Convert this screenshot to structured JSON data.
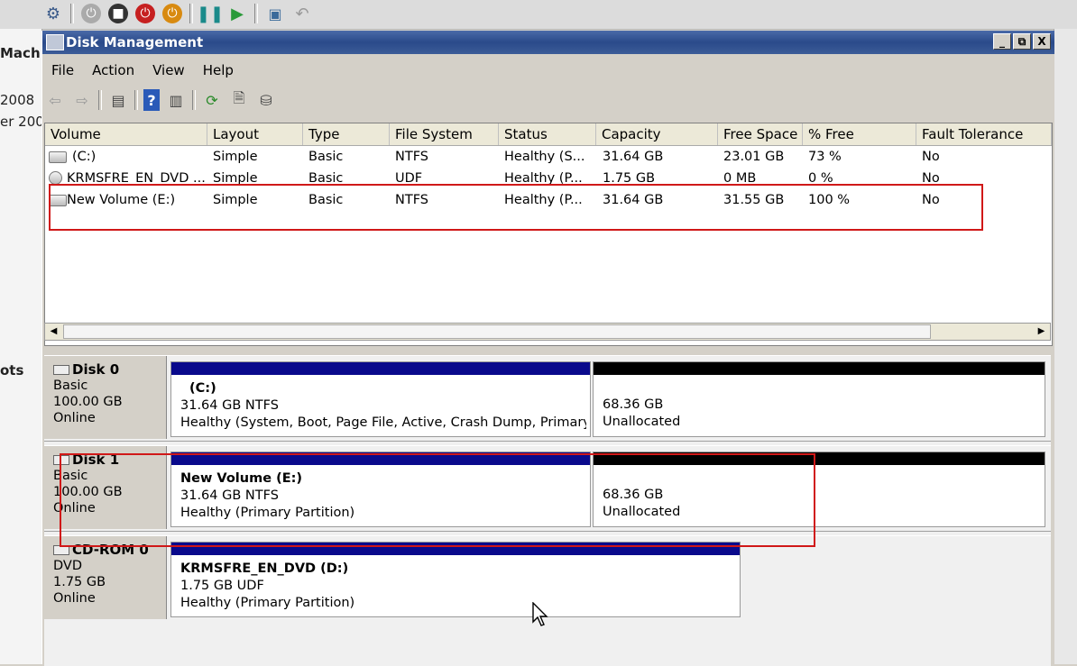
{
  "host": {
    "left_labels": [
      "Mach",
      "2008",
      "er 200",
      "ots"
    ]
  },
  "window": {
    "title": "Disk Management",
    "buttons": [
      "_",
      "⧉",
      "X"
    ]
  },
  "menu": [
    "File",
    "Action",
    "View",
    "Help"
  ],
  "volumes": {
    "columns": [
      "Volume",
      "Layout",
      "Type",
      "File System",
      "Status",
      "Capacity",
      "Free Space",
      "% Free",
      "Fault Tolerance"
    ],
    "rows": [
      {
        "volume": "(C:)",
        "layout": "Simple",
        "type": "Basic",
        "fs": "NTFS",
        "status": "Healthy (S...",
        "capacity": "31.64 GB",
        "free": "23.01 GB",
        "pct": "73 %",
        "fault": "No"
      },
      {
        "volume": "KRMSFRE_EN_DVD ...",
        "layout": "Simple",
        "type": "Basic",
        "fs": "UDF",
        "status": "Healthy (P...",
        "capacity": "1.75 GB",
        "free": "0 MB",
        "pct": "0 %",
        "fault": "No"
      },
      {
        "volume": "New Volume (E:)",
        "layout": "Simple",
        "type": "Basic",
        "fs": "NTFS",
        "status": "Healthy (P...",
        "capacity": "31.64 GB",
        "free": "31.55 GB",
        "pct": "100 %",
        "fault": "No"
      }
    ]
  },
  "disks": [
    {
      "name": "Disk 0",
      "kind": "Basic",
      "size": "100.00 GB",
      "state": "Online",
      "p1": {
        "title": "(C:)",
        "line1": "31.64 GB NTFS",
        "line2": "Healthy (System, Boot, Page File, Active, Crash Dump, Primary Pa"
      },
      "p2": {
        "line1": "68.36 GB",
        "line2": "Unallocated"
      }
    },
    {
      "name": "Disk 1",
      "kind": "Basic",
      "size": "100.00 GB",
      "state": "Online",
      "p1": {
        "title": "New Volume  (E:)",
        "line1": "31.64 GB NTFS",
        "line2": "Healthy (Primary Partition)"
      },
      "p2": {
        "line1": "68.36 GB",
        "line2": "Unallocated"
      }
    },
    {
      "name": "CD-ROM 0",
      "kind": "DVD",
      "size": "1.75 GB",
      "state": "Online",
      "p1": {
        "title": "KRMSFRE_EN_DVD  (D:)",
        "line1": "1.75 GB UDF",
        "line2": "Healthy (Primary Partition)"
      }
    }
  ],
  "colors": {
    "primary_bar": "#0a0a8c",
    "unallocated_bar": "#000000",
    "highlight": "#d01818"
  }
}
